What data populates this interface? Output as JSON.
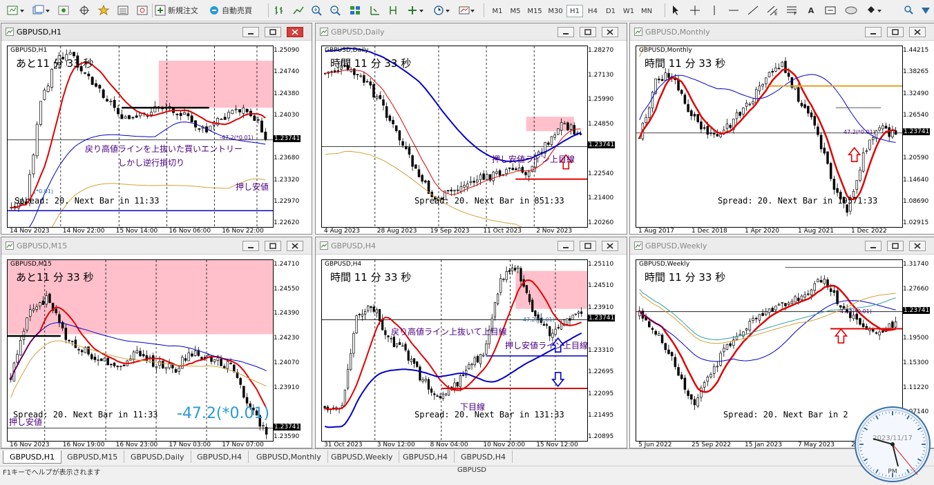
{
  "toolbar": {
    "new_order_label": "新規注文",
    "auto_trade_label": "自動売買",
    "timeframes": [
      "M1",
      "M5",
      "M15",
      "M30",
      "H1",
      "H4",
      "D1",
      "W1",
      "MN"
    ],
    "active_timeframe": "H1"
  },
  "windows": {
    "h1": {
      "title": "GBPUSD,H1",
      "symbol": "GBPUSD,H1",
      "countdown": "あと11 分 33 秒",
      "prices": [
        "1.25090",
        "1.24740",
        "1.24380",
        "1.24030",
        "1.23741",
        "1.23680",
        "1.23320",
        "1.22970",
        "1.22620"
      ],
      "current_price": "1.23741",
      "dates": [
        "14 Nov 2023",
        "14 Nov 22:00",
        "15 Nov 14:00",
        "16 Nov 06:00",
        "16 Nov 22:00"
      ],
      "spread": "Spread: 20. Next Bar in 11:33",
      "ann1": "戻り高値ラインを上抜いた買いエントリー",
      "ann2": "しかし逆行損切り",
      "ann3": "押し安値",
      "ann4": "-47.2(*0.01)",
      "ann5": "(*0.01)"
    },
    "daily": {
      "title": "GBPUSD,Daily",
      "symbol": "GBPUSD,Daily",
      "countdown": "時間 11 分 33 秒",
      "prices": [
        "1.28270",
        "1.27130",
        "1.25990",
        "1.24850",
        "1.23741",
        "1.22540",
        "1.21400",
        "1.20260"
      ],
      "current_price": "1.23741",
      "dates": [
        "4 Aug 2023",
        "28 Aug 2023",
        "19 Sep 2023",
        "11 Oct 2023",
        "2 Nov 2023"
      ],
      "spread": "Spread: 20. Next Bar in 851:33",
      "ann1": "押し安値ライン上目線"
    },
    "monthly": {
      "title": "GBPUSD,Monthly",
      "symbol": "GBPUSD,Monthly",
      "countdown": "時間 11 分 33 秒",
      "prices": [
        "1.44215",
        "1.38265",
        "1.32490",
        "1.26540",
        "1.23741",
        "1.20590",
        "1.14640",
        "1.08690",
        "1.02915"
      ],
      "current_price": "1.23741",
      "dates": [
        "1 Aug 2017",
        "1 Dec 2018",
        "1 Apr 2020",
        "1 Aug 2021",
        "1 Dec 2022"
      ],
      "spread": "Spread: 20. Next Bar in 19571:33",
      "ann1": "47.2(*0.01)"
    },
    "m15": {
      "title": "GBPUSD,M15",
      "symbol": "GBPUSD,M15",
      "countdown": "あと11 分 33 秒",
      "prices": [
        "1.24710",
        "1.24550",
        "1.24390",
        "1.24230",
        "1.24070",
        "1.23910",
        "1.23741",
        "1.23590"
      ],
      "current_price": "1.23741",
      "dates": [
        "16 Nov 2023",
        "16 Nov 19:00",
        "16 Nov 23:00",
        "17 Nov 03:00",
        "17 Nov 07:00"
      ],
      "spread": "Spread: 20. Next Bar in 11:33",
      "ann1": "-47.2(*0.01)",
      "ann2": "押し安値"
    },
    "h4": {
      "title": "GBPUSD,H4",
      "symbol": "GBPUSD,H4",
      "countdown": "時間 11 分 33 秒",
      "prices": [
        "1.25110",
        "1.24510",
        "1.23910",
        "1.23741",
        "1.23310",
        "1.22695",
        "1.22095",
        "1.21495",
        "1.20895"
      ],
      "current_price": "1.23741",
      "dates": [
        "31 Oct 2023",
        "3 Nov 12:00",
        "8 Nov 04:00",
        "10 Nov 20:00",
        "15 Nov 12:00"
      ],
      "spread": "Spread: 20. Next Bar in 131:33",
      "ann1": "戻り高値ライン上抜いて上目線",
      "ann2": "押し安値ライン上目線",
      "ann3": "下目線",
      "ann4": "-47.2(*0.01)"
    },
    "weekly": {
      "title": "GBPUSD,Weekly",
      "symbol": "GBPUSD,Weekly",
      "countdown": "時間 11 分 33 秒",
      "prices": [
        "1.31740",
        "1.27660",
        "1.23741",
        "1.19500",
        "1.15300",
        "1.11220",
        "1.07140",
        "1.02880"
      ],
      "current_price": "1.23741",
      "dates": [
        "5 Jun 2022",
        "25 Sep 2022",
        "15 Jan 2023",
        "7 May 2023",
        "27 Aug 2023"
      ],
      "spread": "Spread: 20. Next Bar in 2",
      "ann1": "47.2(*0.01)"
    }
  },
  "tabs": [
    "GBPUSD,H1",
    "GBPUSD,M15",
    "GBPUSD,Daily",
    "GBPUSD,H4",
    "GBPUSD,Monthly",
    "GBPUSD,Weekly",
    "GBPUSD,H4",
    "GBPUSD,H4"
  ],
  "active_tab": "GBPUSD,H1",
  "status": {
    "help": "F1キーでヘルプが表示されます",
    "symbol": "GBPUSD"
  },
  "clock": {
    "date": "2023/11/17",
    "ampm": "PM"
  },
  "colors": {
    "zone": "#ffc0cb",
    "ma_red": "#e00000",
    "ma_blue": "#0000c8",
    "ma_gold": "#d4a038",
    "line": "#000000"
  }
}
